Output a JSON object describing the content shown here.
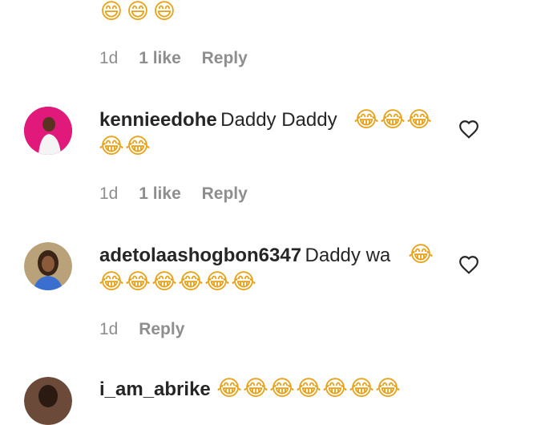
{
  "comments": [
    {
      "text_tail_emojis": [
        "😄",
        "😄",
        "😄"
      ],
      "time": "1d",
      "likes": "1 like",
      "reply": "Reply"
    },
    {
      "username": "kennieedohe",
      "text": "Daddy Daddy",
      "emojis_line1": [
        "😂",
        "😂",
        "😂"
      ],
      "emojis_line2": [
        "😂",
        "😂"
      ],
      "time": "1d",
      "likes": "1 like",
      "reply": "Reply",
      "avatar_color": "#e0197a"
    },
    {
      "username": "adetolaashogbon6347",
      "text": "Daddy wa",
      "emojis_line1": [
        "😂"
      ],
      "emojis_line2": [
        "😂",
        "😂",
        "😂",
        "😂",
        "😂",
        "😂"
      ],
      "time": "1d",
      "reply": "Reply",
      "avatar_color": "#5a3a2e"
    },
    {
      "username": "i_am_abrike",
      "emojis_line1": [
        "😂",
        "😂",
        "😂",
        "😂",
        "😂",
        "😂",
        "😂"
      ]
    }
  ],
  "icons": {
    "like": "heart-outline-icon"
  }
}
